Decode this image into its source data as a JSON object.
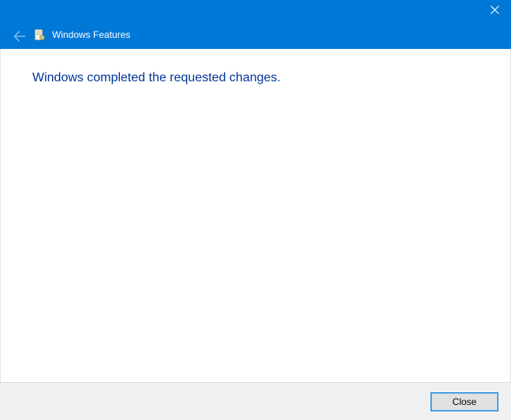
{
  "titlebar": {
    "title": "Windows Features"
  },
  "content": {
    "message": "Windows completed the requested changes."
  },
  "footer": {
    "close_label": "Close"
  }
}
